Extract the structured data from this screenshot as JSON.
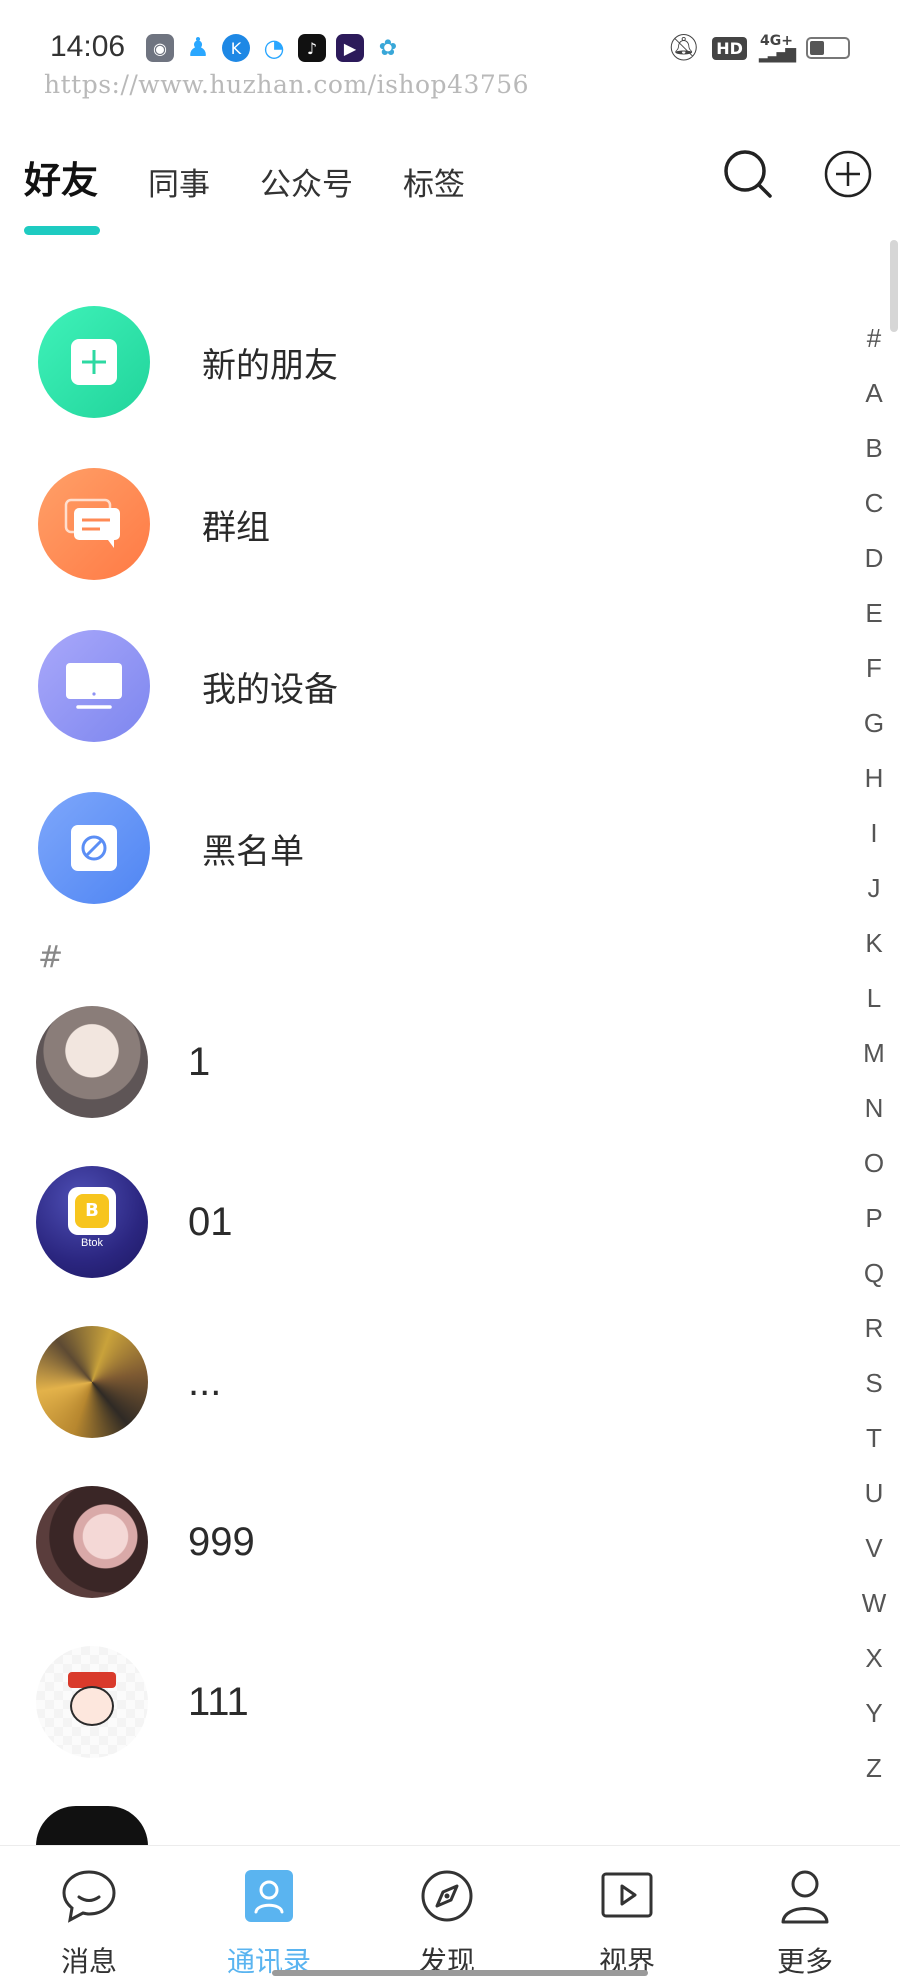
{
  "status": {
    "time": "14:06",
    "network": "4G+",
    "hd": "HD"
  },
  "watermark": "https://www.huzhan.com/ishop43756",
  "tabs": [
    {
      "label": "好友",
      "active": true
    },
    {
      "label": "同事",
      "active": false
    },
    {
      "label": "公众号",
      "active": false
    },
    {
      "label": "标签",
      "active": false
    }
  ],
  "header_icons": [
    "search-icon",
    "add-circle-icon"
  ],
  "features": [
    {
      "label": "新的朋友",
      "icon": "add-friend-icon",
      "color": "#2fe0a8"
    },
    {
      "label": "群组",
      "icon": "group-chat-icon",
      "color": "#ff8a55"
    },
    {
      "label": "我的设备",
      "icon": "monitor-icon",
      "color": "#8f93f3"
    },
    {
      "label": "黑名单",
      "icon": "block-icon",
      "color": "#5b8ef5"
    }
  ],
  "section_header": "#",
  "contacts": [
    {
      "name": "1"
    },
    {
      "name": "01"
    },
    {
      "name": "..."
    },
    {
      "name": "999"
    },
    {
      "name": "111"
    }
  ],
  "avatar_badge": "Btok",
  "index_letters": [
    "#",
    "A",
    "B",
    "C",
    "D",
    "E",
    "F",
    "G",
    "H",
    "I",
    "J",
    "K",
    "L",
    "M",
    "N",
    "O",
    "P",
    "Q",
    "R",
    "S",
    "T",
    "U",
    "V",
    "W",
    "X",
    "Y",
    "Z"
  ],
  "bottom_nav": [
    {
      "label": "消息",
      "icon": "chat-bubble-icon",
      "active": false
    },
    {
      "label": "通讯录",
      "icon": "contacts-icon",
      "active": true
    },
    {
      "label": "发现",
      "icon": "compass-icon",
      "active": false
    },
    {
      "label": "视界",
      "icon": "video-play-icon",
      "active": false
    },
    {
      "label": "更多",
      "icon": "profile-icon",
      "active": false
    }
  ],
  "colors": {
    "accent": "#1ecbc1",
    "nav_active": "#5ab4f0"
  }
}
